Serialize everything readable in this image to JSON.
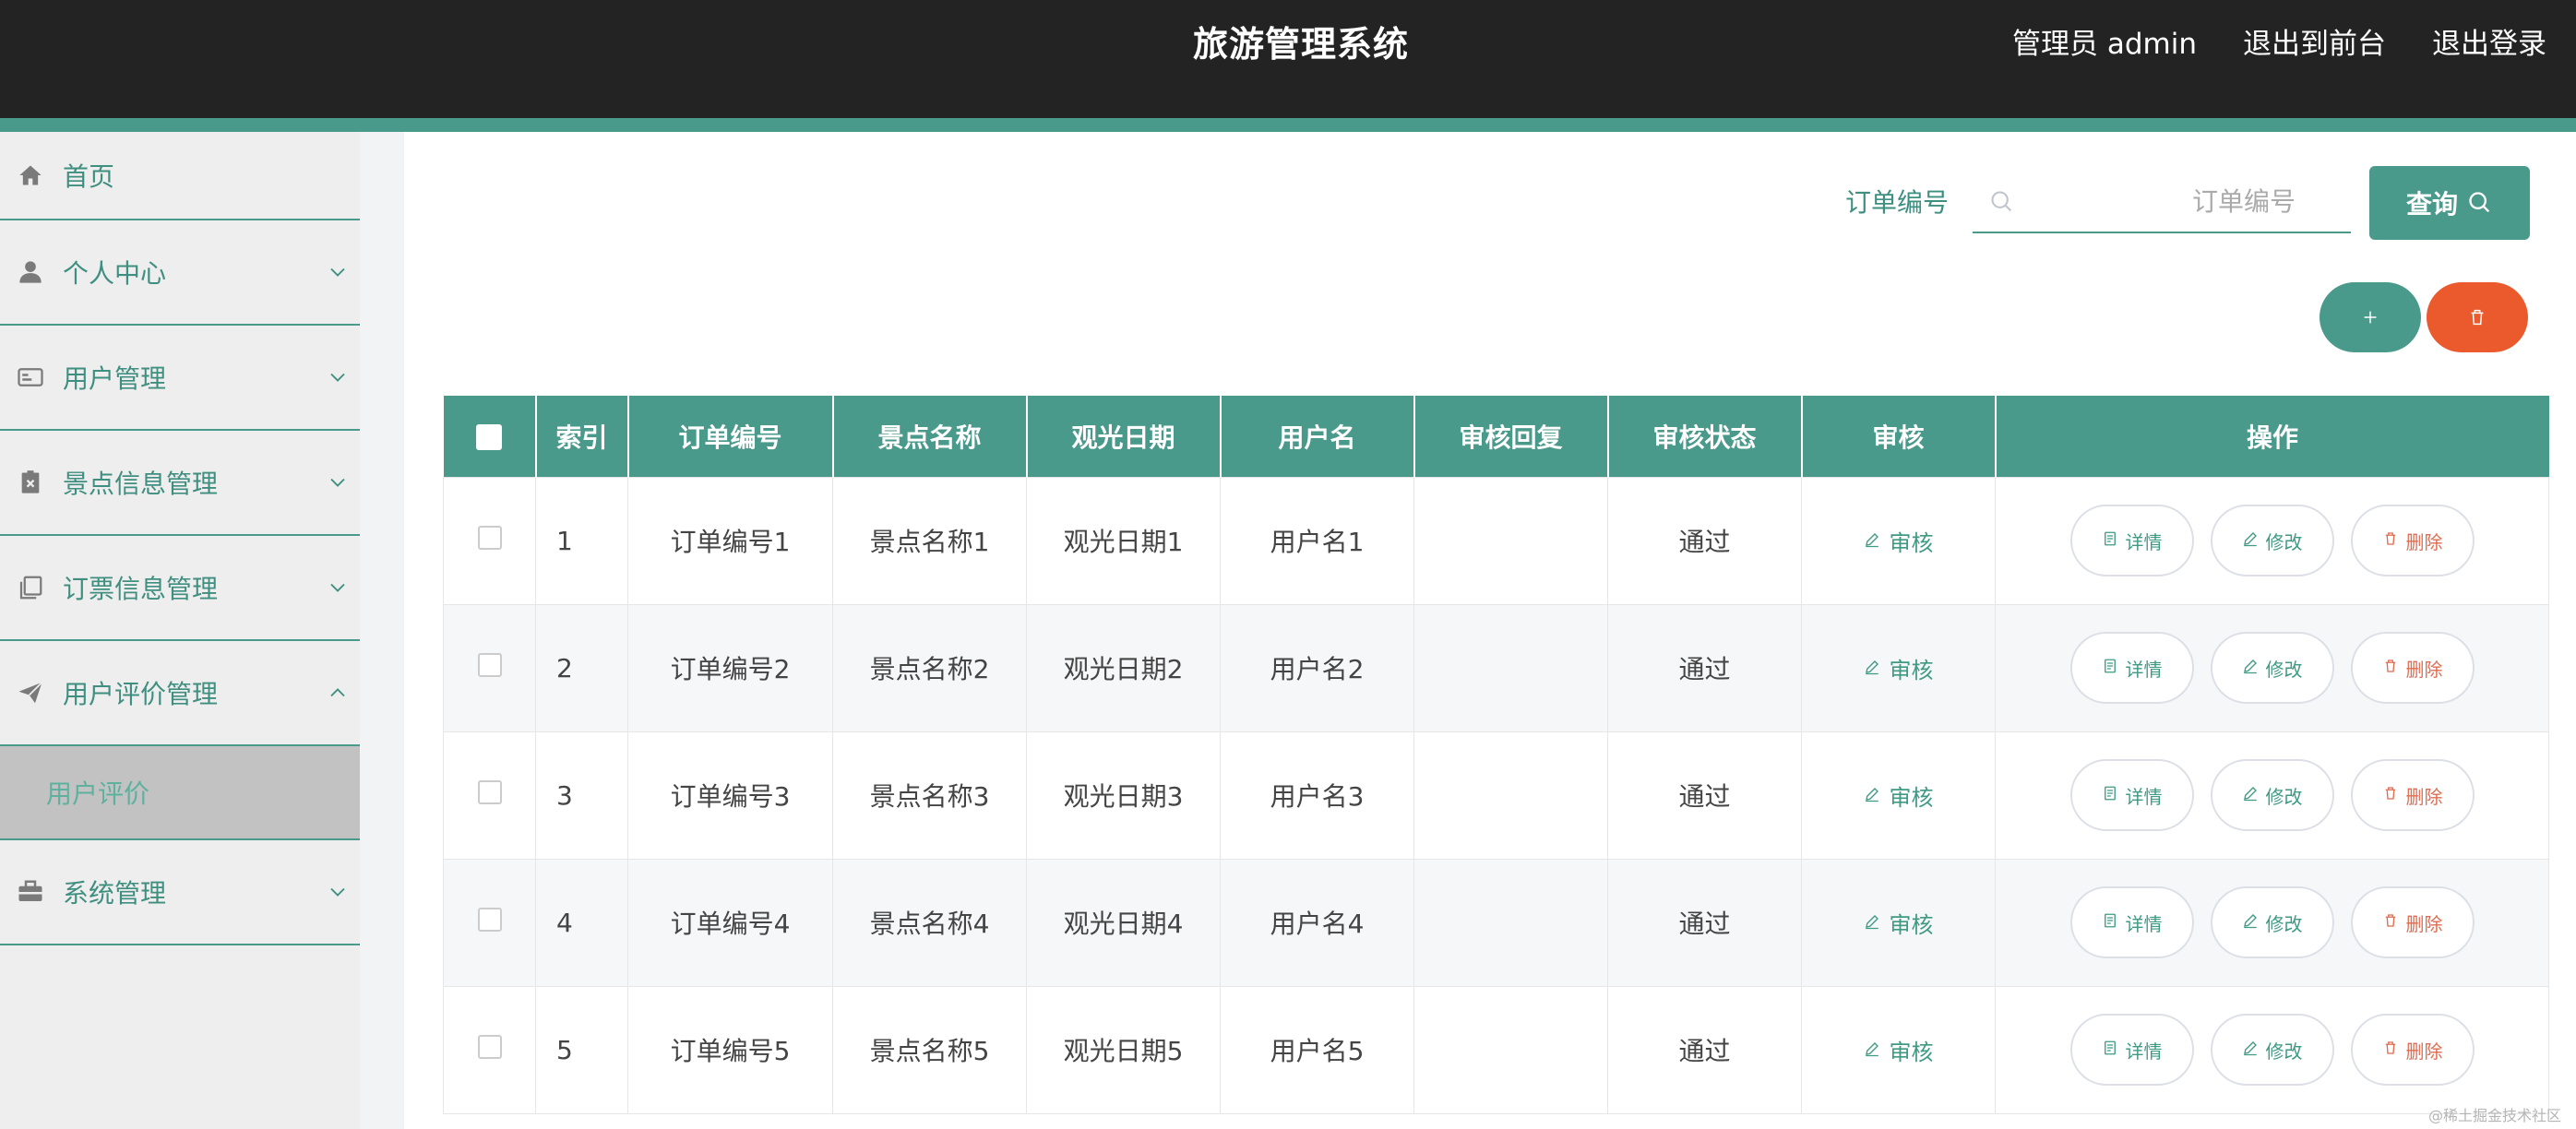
{
  "header": {
    "title": "旅游管理系统",
    "links": [
      "管理员 admin",
      "退出到前台",
      "退出登录"
    ]
  },
  "sidebar": {
    "items": [
      {
        "label": "首页",
        "icon": "home-icon",
        "has_arrow": false
      },
      {
        "label": "个人中心",
        "icon": "user-icon",
        "has_arrow": true,
        "arrow": "down"
      },
      {
        "label": "用户管理",
        "icon": "id-card-icon",
        "has_arrow": true,
        "arrow": "down"
      },
      {
        "label": "景点信息管理",
        "icon": "ticket-icon",
        "has_arrow": true,
        "arrow": "down"
      },
      {
        "label": "订票信息管理",
        "icon": "copy-icon",
        "has_arrow": true,
        "arrow": "down"
      },
      {
        "label": "用户评价管理",
        "icon": "send-icon",
        "has_arrow": true,
        "arrow": "up"
      },
      {
        "label": "用户评价",
        "sub": true
      },
      {
        "label": "系统管理",
        "icon": "briefcase-icon",
        "has_arrow": true,
        "arrow": "down"
      }
    ]
  },
  "search": {
    "label": "订单编号",
    "placeholder": "订单编号",
    "value": "",
    "button_label": "查询"
  },
  "table": {
    "columns": [
      "索引",
      "订单编号",
      "景点名称",
      "观光日期",
      "用户名",
      "审核回复",
      "审核状态",
      "审核",
      "操作"
    ],
    "audit_label": "审核",
    "op_labels": {
      "detail": "详情",
      "edit": "修改",
      "delete": "删除"
    },
    "rows": [
      {
        "index": "1",
        "order_no": "订单编号1",
        "spot": "景点名称1",
        "date": "观光日期1",
        "user": "用户名1",
        "reply": "",
        "status": "通过"
      },
      {
        "index": "2",
        "order_no": "订单编号2",
        "spot": "景点名称2",
        "date": "观光日期2",
        "user": "用户名2",
        "reply": "",
        "status": "通过"
      },
      {
        "index": "3",
        "order_no": "订单编号3",
        "spot": "景点名称3",
        "date": "观光日期3",
        "user": "用户名3",
        "reply": "",
        "status": "通过"
      },
      {
        "index": "4",
        "order_no": "订单编号4",
        "spot": "景点名称4",
        "date": "观光日期4",
        "user": "用户名4",
        "reply": "",
        "status": "通过"
      },
      {
        "index": "5",
        "order_no": "订单编号5",
        "spot": "景点名称5",
        "date": "观光日期5",
        "user": "用户名5",
        "reply": "",
        "status": "通过"
      }
    ]
  },
  "colors": {
    "accent": "#4a9a8b",
    "danger": "#ea5a2c",
    "header_bg": "#232323"
  },
  "watermark": "@稀土掘金技术社区"
}
